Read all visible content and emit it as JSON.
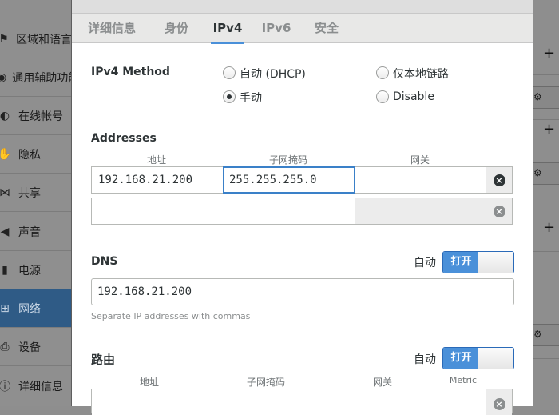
{
  "background": {
    "sidebar": [
      {
        "label": "区域和语言",
        "icon": "flag-icon",
        "glyph": "⚑",
        "active": false
      },
      {
        "label": "通用辅助功能",
        "icon": "accessibility-icon",
        "glyph": "◉",
        "active": false
      },
      {
        "label": "在线帐号",
        "icon": "online-accounts-icon",
        "glyph": "◐",
        "active": false
      },
      {
        "label": "隐私",
        "icon": "privacy-icon",
        "glyph": "✋",
        "active": false
      },
      {
        "label": "共享",
        "icon": "share-icon",
        "glyph": "⋈",
        "active": false
      },
      {
        "label": "声音",
        "icon": "speaker-icon",
        "glyph": "◀",
        "active": false
      },
      {
        "label": "电源",
        "icon": "battery-icon",
        "glyph": "▮",
        "active": false
      },
      {
        "label": "网络",
        "icon": "network-icon",
        "glyph": "⊞",
        "active": true
      },
      {
        "label": "设备",
        "icon": "printer-icon",
        "glyph": "⎙",
        "active": false
      },
      {
        "label": "详细信息",
        "icon": "info-icon",
        "glyph": "ⓘ",
        "active": false
      }
    ]
  },
  "dialog": {
    "tabs": [
      {
        "label": "详细信息",
        "active": false
      },
      {
        "label": "身份",
        "active": false
      },
      {
        "label": "IPv4",
        "active": true
      },
      {
        "label": "IPv6",
        "active": false
      },
      {
        "label": "安全",
        "active": false
      }
    ],
    "method": {
      "label": "IPv4 Method",
      "options": [
        {
          "label": "自动 (DHCP)",
          "checked": false
        },
        {
          "label": "仅本地链路",
          "checked": false
        },
        {
          "label": "手动",
          "checked": true
        },
        {
          "label": "Disable",
          "checked": false
        }
      ]
    },
    "addresses": {
      "title": "Addresses",
      "headers": [
        "地址",
        "子网掩码",
        "网关"
      ],
      "rows": [
        {
          "address": "192.168.21.200",
          "netmask": "255.255.255.0",
          "gateway": ""
        },
        {
          "address": "",
          "netmask": "",
          "gateway": ""
        }
      ]
    },
    "dns": {
      "title": "DNS",
      "auto_label": "自动",
      "switch_label": "打开",
      "switch_on": true,
      "value": "192.168.21.200",
      "hint": "Separate IP addresses with commas"
    },
    "routes": {
      "title": "路由",
      "auto_label": "自动",
      "switch_label": "打开",
      "switch_on": true,
      "headers": [
        "地址",
        "子网掩码",
        "网关",
        "Metric"
      ]
    }
  }
}
